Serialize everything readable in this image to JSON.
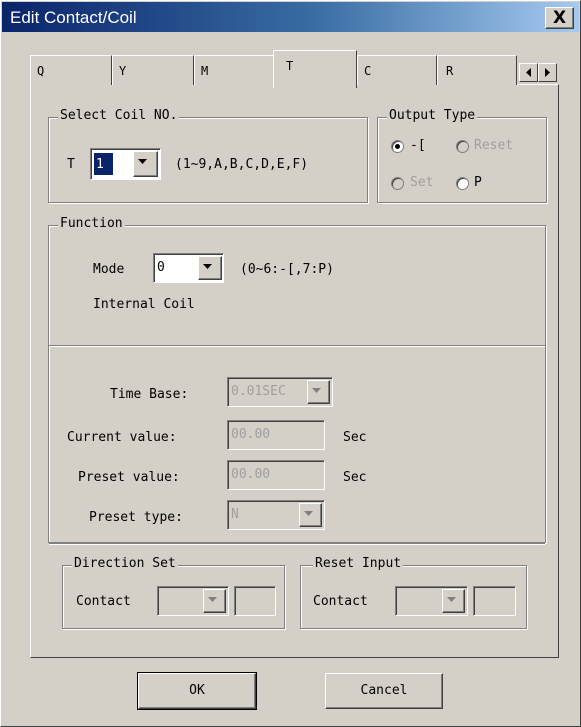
{
  "window": {
    "title": "Edit Contact/Coil",
    "close_glyph": "X"
  },
  "tabs": [
    {
      "label": "Q"
    },
    {
      "label": "Y"
    },
    {
      "label": "M"
    },
    {
      "label": "T",
      "active": true
    },
    {
      "label": "C"
    },
    {
      "label": "R"
    }
  ],
  "select_coil": {
    "legend": "Select Coil NO.",
    "prefix": "T",
    "selected": "1",
    "hint": "(1~9,A,B,C,D,E,F)"
  },
  "output_type": {
    "legend": "Output Type",
    "options": [
      {
        "label": "-[",
        "checked": true,
        "enabled": true
      },
      {
        "label": "Reset",
        "checked": false,
        "enabled": false
      },
      {
        "label": "Set",
        "checked": false,
        "enabled": false
      },
      {
        "label": "P",
        "checked": false,
        "enabled": true
      }
    ]
  },
  "function": {
    "legend": "Function",
    "mode_label": "Mode",
    "mode_value": "0",
    "mode_hint": "(0~6:-[,7:P)",
    "description": "Internal Coil"
  },
  "timer": {
    "time_base_label": "Time Base:",
    "time_base_value": "0.01SEC",
    "current_label": "Current value:",
    "current_value": "00.00",
    "current_unit": "Sec",
    "preset_label": "Preset value:",
    "preset_value": "00.00",
    "preset_unit": "Sec",
    "preset_type_label": "Preset type:",
    "preset_type_value": "N"
  },
  "direction_set": {
    "legend": "Direction Set",
    "contact_label": "Contact"
  },
  "reset_input": {
    "legend": "Reset Input",
    "contact_label": "Contact"
  },
  "buttons": {
    "ok": "OK",
    "cancel": "Cancel"
  },
  "colors": {
    "face": "#d4d0c8",
    "title_start": "#0a246a",
    "title_end": "#a6caf0",
    "disabled_text": "#a0a0a0"
  }
}
